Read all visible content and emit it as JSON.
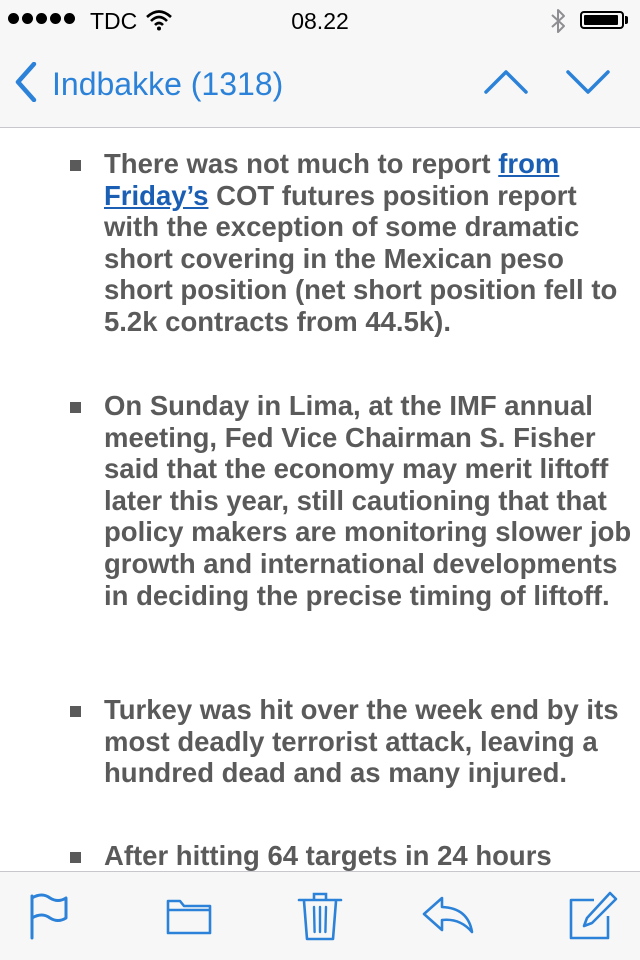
{
  "status_bar": {
    "carrier": "TDC",
    "time": "08.22",
    "icons": [
      "signal-dots",
      "wifi-icon",
      "bluetooth-icon",
      "battery-icon"
    ]
  },
  "nav": {
    "back_label": "Indbakke (1318)",
    "icons": [
      "chevron-left-icon",
      "chevron-up-icon",
      "chevron-down-icon"
    ],
    "accent_color": "#2c82d8"
  },
  "email": {
    "bullets": [
      {
        "text_before": "There was not much to report ",
        "link": "from Friday’s",
        "text_after": " COT futures position report with the exception of some dramatic short covering in the Mexican peso short position (net short position fell to 5.2k contracts from 44.5k)."
      },
      {
        "text": "On Sunday in Lima, at the IMF annual meeting, Fed Vice Chairman S. Fisher said that the economy may merit liftoff later this year, still cautioning that that policy makers are monitoring slower job growth and international developments in deciding the precise timing of liftoff."
      },
      {
        "text": "Turkey was hit over the week end by its most deadly terrorist attack, leaving a hundred dead and as many injured."
      },
      {
        "text": "After hitting 64 targets in 24 hours"
      }
    ],
    "text_color": "#5a5a5a",
    "link_color": "#1a5fb4"
  },
  "toolbar": {
    "icons": [
      "flag-icon",
      "folder-icon",
      "trash-icon",
      "reply-icon",
      "compose-icon"
    ]
  }
}
